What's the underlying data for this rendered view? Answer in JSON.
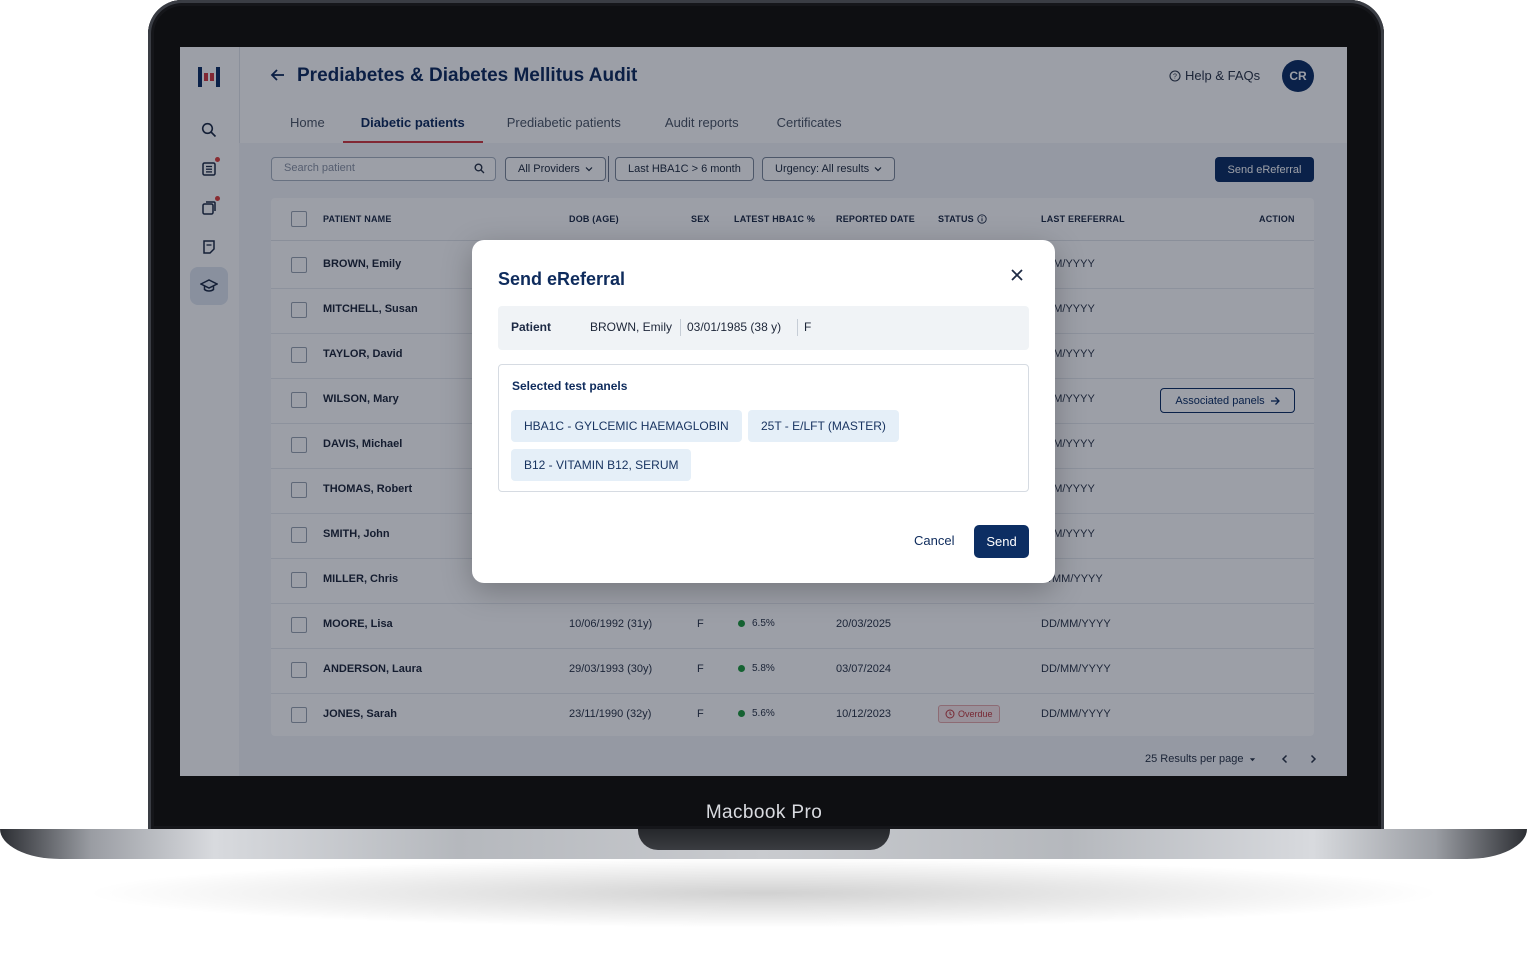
{
  "device": {
    "brand_label": "Macbook Pro"
  },
  "app": {
    "title": "Prediabetes & Diabetes Mellitus Audit",
    "help_label": "Help & FAQs",
    "avatar_initials": "CR",
    "brand_colors": {
      "primary": "#0c2e63",
      "accent": "#d23a40"
    }
  },
  "rail": {
    "icons": [
      "search-icon",
      "list-icon",
      "documents-icon",
      "report-icon",
      "graduation-cap-icon"
    ]
  },
  "tabs": [
    {
      "label": "Home"
    },
    {
      "label": "Diabetic patients"
    },
    {
      "label": "Prediabetic patients"
    },
    {
      "label": "Audit reports"
    },
    {
      "label": "Certificates"
    }
  ],
  "toolbar": {
    "search_placeholder": "Search patient",
    "providers_label": "All Providers",
    "hba1c_filter_label": "Last HBA1C > 6 month",
    "urgency_label": "Urgency: All results",
    "send_ereferral_label": "Send eReferral"
  },
  "table": {
    "headers": {
      "name": "PATIENT NAME",
      "dob": "DOB (AGE)",
      "sex": "SEX",
      "hba1c": "LATEST HBA1C %",
      "reported": "REPORTED DATE",
      "status": "STATUS",
      "last_ereferral": "LAST EREFERRAL",
      "action": "ACTION"
    },
    "rows": [
      {
        "name": "BROWN, Emily",
        "last_ereferral": "/MM/YYYY"
      },
      {
        "name": "MITCHELL, Susan",
        "last_ereferral": "/MM/YYYY"
      },
      {
        "name": "TAYLOR, David",
        "last_ereferral": "/MM/YYYY"
      },
      {
        "name": "WILSON, Mary",
        "last_ereferral": "/MM/YYYY",
        "action": "Associated panels"
      },
      {
        "name": "DAVIS, Michael",
        "last_ereferral": "/MM/YYYY"
      },
      {
        "name": "THOMAS, Robert",
        "last_ereferral": "/MM/YYYY"
      },
      {
        "name": "SMITH, John",
        "last_ereferral": "/MM/YYYY"
      },
      {
        "name": "MILLER, Chris",
        "last_ereferral": "D/MM/YYYY"
      },
      {
        "name": "MOORE, Lisa",
        "dob": "10/06/1992 (31y)",
        "sex": "F",
        "hba1c": "6.5%",
        "reported": "20/03/2025",
        "last_ereferral": "DD/MM/YYYY"
      },
      {
        "name": "ANDERSON, Laura",
        "dob": "29/03/1993 (30y)",
        "sex": "F",
        "hba1c": "5.8%",
        "reported": "03/07/2024",
        "last_ereferral": "DD/MM/YYYY"
      },
      {
        "name": "JONES, Sarah",
        "dob": "23/11/1990 (32y)",
        "sex": "F",
        "hba1c": "5.6%",
        "reported": "10/12/2023",
        "status": "Overdue",
        "last_ereferral": "DD/MM/YYYY"
      }
    ]
  },
  "pagination": {
    "per_page_label": "25 Results per page"
  },
  "modal": {
    "title": "Send eReferral",
    "patient_label": "Patient",
    "patient_name": "BROWN, Emily",
    "patient_dob": "03/01/1985 (38 y)",
    "patient_sex": "F",
    "panels_label": "Selected test panels",
    "panels": [
      "HBA1C - GYLCEMIC HAEMAGLOBIN",
      "25T - E/LFT (MASTER)",
      "B12 - VITAMIN B12, SERUM"
    ],
    "cancel_label": "Cancel",
    "send_label": "Send"
  }
}
